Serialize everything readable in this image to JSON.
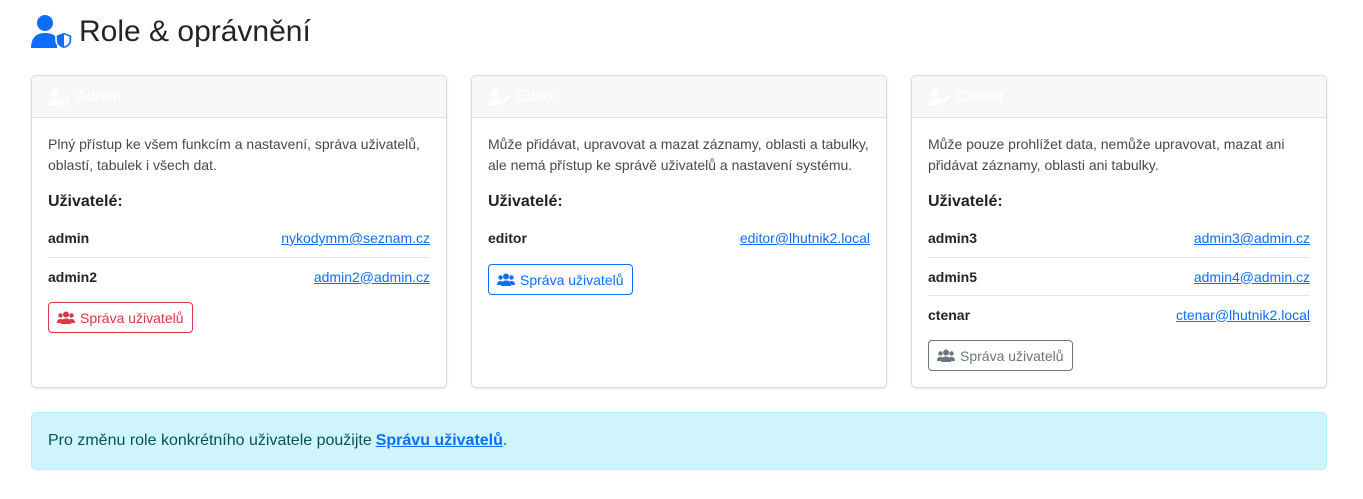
{
  "page": {
    "title": "Role & oprávnění",
    "icon": "user-shield-icon",
    "accent": "#0d6efd"
  },
  "roles": [
    {
      "title": "Admin",
      "icon": "user-gear-icon",
      "description": "Plný přístup ke všem funkcím a nastavení, správa uživatelů, oblastí, tabulek i všech dat.",
      "users_heading": "Uživatelé:",
      "users": [
        {
          "name": "admin",
          "email": "nykodymm@seznam.cz"
        },
        {
          "name": "admin2",
          "email": "admin2@admin.cz"
        }
      ],
      "button_label": "Správa uživatelů",
      "button_color": "#dc3545"
    },
    {
      "title": "Editor",
      "icon": "user-pen-icon",
      "description": "Může přidávat, upravovat a mazat záznamy, oblasti a tabulky, ale nemá přístup ke správě uživatelů a nastavení systému.",
      "users_heading": "Uživatelé:",
      "users": [
        {
          "name": "editor",
          "email": "editor@lhutnik2.local"
        }
      ],
      "button_label": "Správa uživatelů",
      "button_color": "#0d6efd"
    },
    {
      "title": "Ctenar",
      "icon": "user-check-icon",
      "description": "Může pouze prohlížet data, nemůže upravovat, mazat ani přidávat záznamy, oblasti ani tabulky.",
      "users_heading": "Uživatelé:",
      "users": [
        {
          "name": "admin3",
          "email": "admin3@admin.cz"
        },
        {
          "name": "admin5",
          "email": "admin4@admin.cz"
        },
        {
          "name": "ctenar",
          "email": "ctenar@lhutnik2.local"
        }
      ],
      "button_label": "Správa uživatelů",
      "button_color": "#6c757d"
    }
  ],
  "alert": {
    "text": "Pro změnu role konkrétního uživatele použijte",
    "link_label": "Správu uživatelů",
    "suffix": "."
  }
}
